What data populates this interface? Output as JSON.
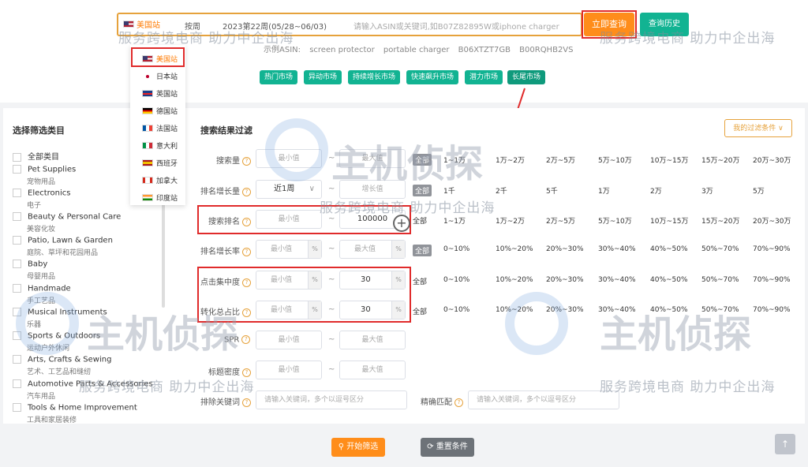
{
  "search": {
    "site": "美国站",
    "type": "按周",
    "period": "2023第22周(05/28~06/03)",
    "placeholder": "请输入ASIN或关键词,如B07Z82895W或iphone charger",
    "query_button": "立即查询",
    "history_button": "查询历史"
  },
  "example": {
    "label": "示例ASIN:",
    "items": [
      "screen protector",
      "portable charger",
      "B06XTZT7GB",
      "B00RQHB2VS"
    ]
  },
  "markets": [
    "热门市场",
    "异动市场",
    "持续增长市场",
    "快速飙升市场",
    "潜力市场",
    "长尾市场"
  ],
  "site_dropdown": [
    {
      "label": "美国站",
      "flag": "us"
    },
    {
      "label": "日本站",
      "flag": "jp"
    },
    {
      "label": "英国站",
      "flag": "uk"
    },
    {
      "label": "德国站",
      "flag": "de"
    },
    {
      "label": "法国站",
      "flag": "fr"
    },
    {
      "label": "意大利",
      "flag": "it"
    },
    {
      "label": "西班牙",
      "flag": "es"
    },
    {
      "label": "加拿大",
      "flag": "ca"
    },
    {
      "label": "印度站",
      "flag": "in"
    }
  ],
  "category": {
    "title": "选择筛选类目",
    "items": [
      {
        "en": "全部类目",
        "cn": ""
      },
      {
        "en": "Pet Supplies",
        "cn": "宠物用品"
      },
      {
        "en": "Electronics",
        "cn": "电子"
      },
      {
        "en": "Beauty & Personal Care",
        "cn": "美容化妆"
      },
      {
        "en": "Patio, Lawn & Garden",
        "cn": "庭院、草坪和花园用品"
      },
      {
        "en": "Baby",
        "cn": "母婴用品"
      },
      {
        "en": "Handmade",
        "cn": "手工艺品"
      },
      {
        "en": "Musical Instruments",
        "cn": "乐器"
      },
      {
        "en": "Sports & Outdoors",
        "cn": "运动户外休闲"
      },
      {
        "en": "Arts, Crafts & Sewing",
        "cn": "艺术、工艺品和缝纫"
      },
      {
        "en": "Automotive Parts & Accessories",
        "cn": "汽车用品"
      },
      {
        "en": "Tools & Home Improvement",
        "cn": "工具和家居装修"
      }
    ]
  },
  "filter": {
    "title": "搜索结果过滤",
    "saved_button": "我的过滤条件 ∨",
    "min_placeholder": "最小值",
    "max_placeholder": "最大值",
    "growth_placeholder": "增长值",
    "all": "全部",
    "rows": {
      "search_volume": {
        "label": "搜索量",
        "options": [
          "1~1万",
          "1万~2万",
          "2万~5万",
          "5万~10万",
          "10万~15万",
          "15万~20万",
          "20万~30万"
        ]
      },
      "rank_growth": {
        "label": "排名增长量",
        "period": "近1周",
        "options": [
          "1千",
          "2千",
          "5千",
          "1万",
          "2万",
          "3万",
          "5万"
        ]
      },
      "search_rank": {
        "label": "搜索排名",
        "max": "100000",
        "options": [
          "1~1万",
          "1万~2万",
          "2万~5万",
          "5万~10万",
          "10万~15万",
          "15万~20万",
          "20万~30万"
        ]
      },
      "rank_growth_rate": {
        "label": "排名增长率",
        "options": [
          "0~10%",
          "10%~20%",
          "20%~30%",
          "30%~40%",
          "40%~50%",
          "50%~70%",
          "70%~90%"
        ]
      },
      "click_concentration": {
        "label": "点击集中度",
        "max": "30",
        "options": [
          "0~10%",
          "10%~20%",
          "20%~30%",
          "30%~40%",
          "40%~50%",
          "50%~70%",
          "70%~90%"
        ]
      },
      "conversion_share": {
        "label": "转化总占比",
        "max": "30",
        "options": [
          "0~10%",
          "10%~20%",
          "20%~30%",
          "30%~40%",
          "40%~50%",
          "50%~70%",
          "70%~90%"
        ]
      },
      "spr": {
        "label": "SPR"
      },
      "title_density": {
        "label": "标题密度"
      },
      "exclude_keywords": {
        "label": "排除关键词",
        "placeholder": "请输入关键词，多个以逗号区分"
      },
      "exact_match": {
        "label": "精确匹配",
        "placeholder": "请输入关键词，多个以逗号区分"
      }
    },
    "pct_unit": "%",
    "tilde": "~"
  },
  "actions": {
    "start": "开始筛选",
    "reset": "重置条件"
  },
  "watermark": {
    "text": "服务跨境电商 助力中企出海",
    "brand": "主机侦探"
  },
  "colors": {
    "accent": "#ff8d1a",
    "green": "#12b392",
    "highlight": "#e02b2b"
  }
}
